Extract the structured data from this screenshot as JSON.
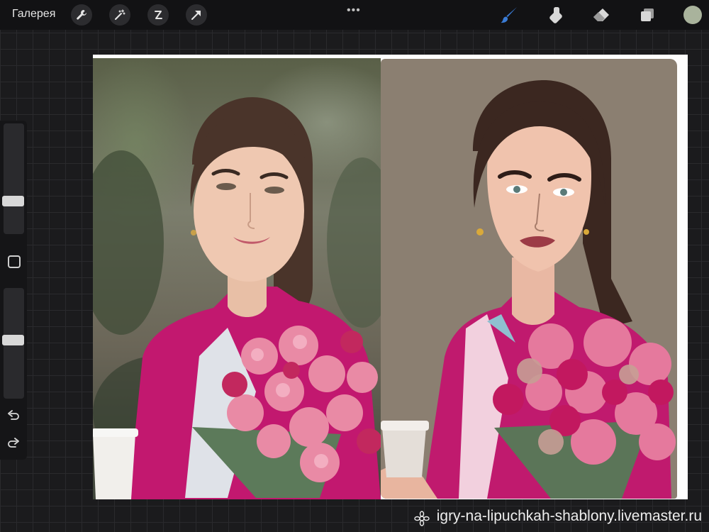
{
  "topbar": {
    "gallery_label": "Галерея",
    "left_tools": [
      "wrench-icon",
      "magic-wand-icon",
      "selection-s-icon",
      "transform-arrow-icon"
    ],
    "more_dots": "•••",
    "right_tools": [
      "brush-icon",
      "smudge-icon",
      "eraser-icon",
      "layers-icon"
    ],
    "current_color": "#a9b39c",
    "active_tool_color": "#3a7bd5"
  },
  "sidebar": {
    "brush_size_level": 0.65,
    "opacity_level": 0.5
  },
  "canvas": {
    "left_image": "reference-photo",
    "right_image": "digital-painting"
  },
  "watermark": {
    "text": "igry-na-lipuchkah-shablony.livemaster.ru"
  }
}
